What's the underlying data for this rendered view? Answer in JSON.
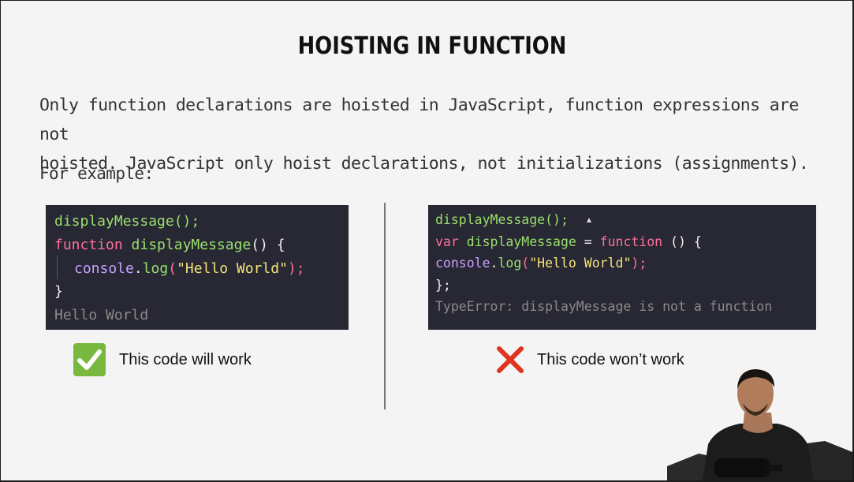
{
  "slide": {
    "title": "HOISTING IN FUNCTION",
    "paragraph_line1": "Only function declarations are hoisted in JavaScript, function expressions are not",
    "paragraph_line2": "hoisted. JavaScript only hoist declarations, not initializations (assignments).",
    "example_label": "For example:"
  },
  "left_example": {
    "line1_call": "displayMessage();",
    "line2_keyword": "function",
    "line2_name": "displayMessage",
    "line2_rest": "() {",
    "line3_obj": "console",
    "line3_dot": ".",
    "line3_method": "log",
    "line3_open": "(",
    "line3_string": "\"Hello World\"",
    "line3_close": ");",
    "line4": "}",
    "output": "Hello World",
    "caption": "This code will work",
    "status_icon": "green-checkmark-icon",
    "status_color": "#79b83e"
  },
  "right_example": {
    "line1_call": "displayMessage();",
    "line2_keyword": "var",
    "line2_name": "displayMessage",
    "line2_eq": " = ",
    "line2_keyword2": "function",
    "line2_rest": " () {",
    "line3_obj": "console",
    "line3_dot": ".",
    "line3_method": "log",
    "line3_open": "(",
    "line3_string": "\"Hello World\"",
    "line3_close": ");",
    "line4": "};",
    "output": "TypeError: displayMessage is not a function",
    "caption": "This code won’t work",
    "status_icon": "red-cross-icon",
    "status_color": "#e0341f"
  },
  "colors": {
    "code_background": "#272833",
    "function_name": "#9ae06d",
    "keyword": "#ff6f9a",
    "object": "#c9a0ff",
    "string": "#f5e27a",
    "slide_background": "#f4f4f4"
  }
}
